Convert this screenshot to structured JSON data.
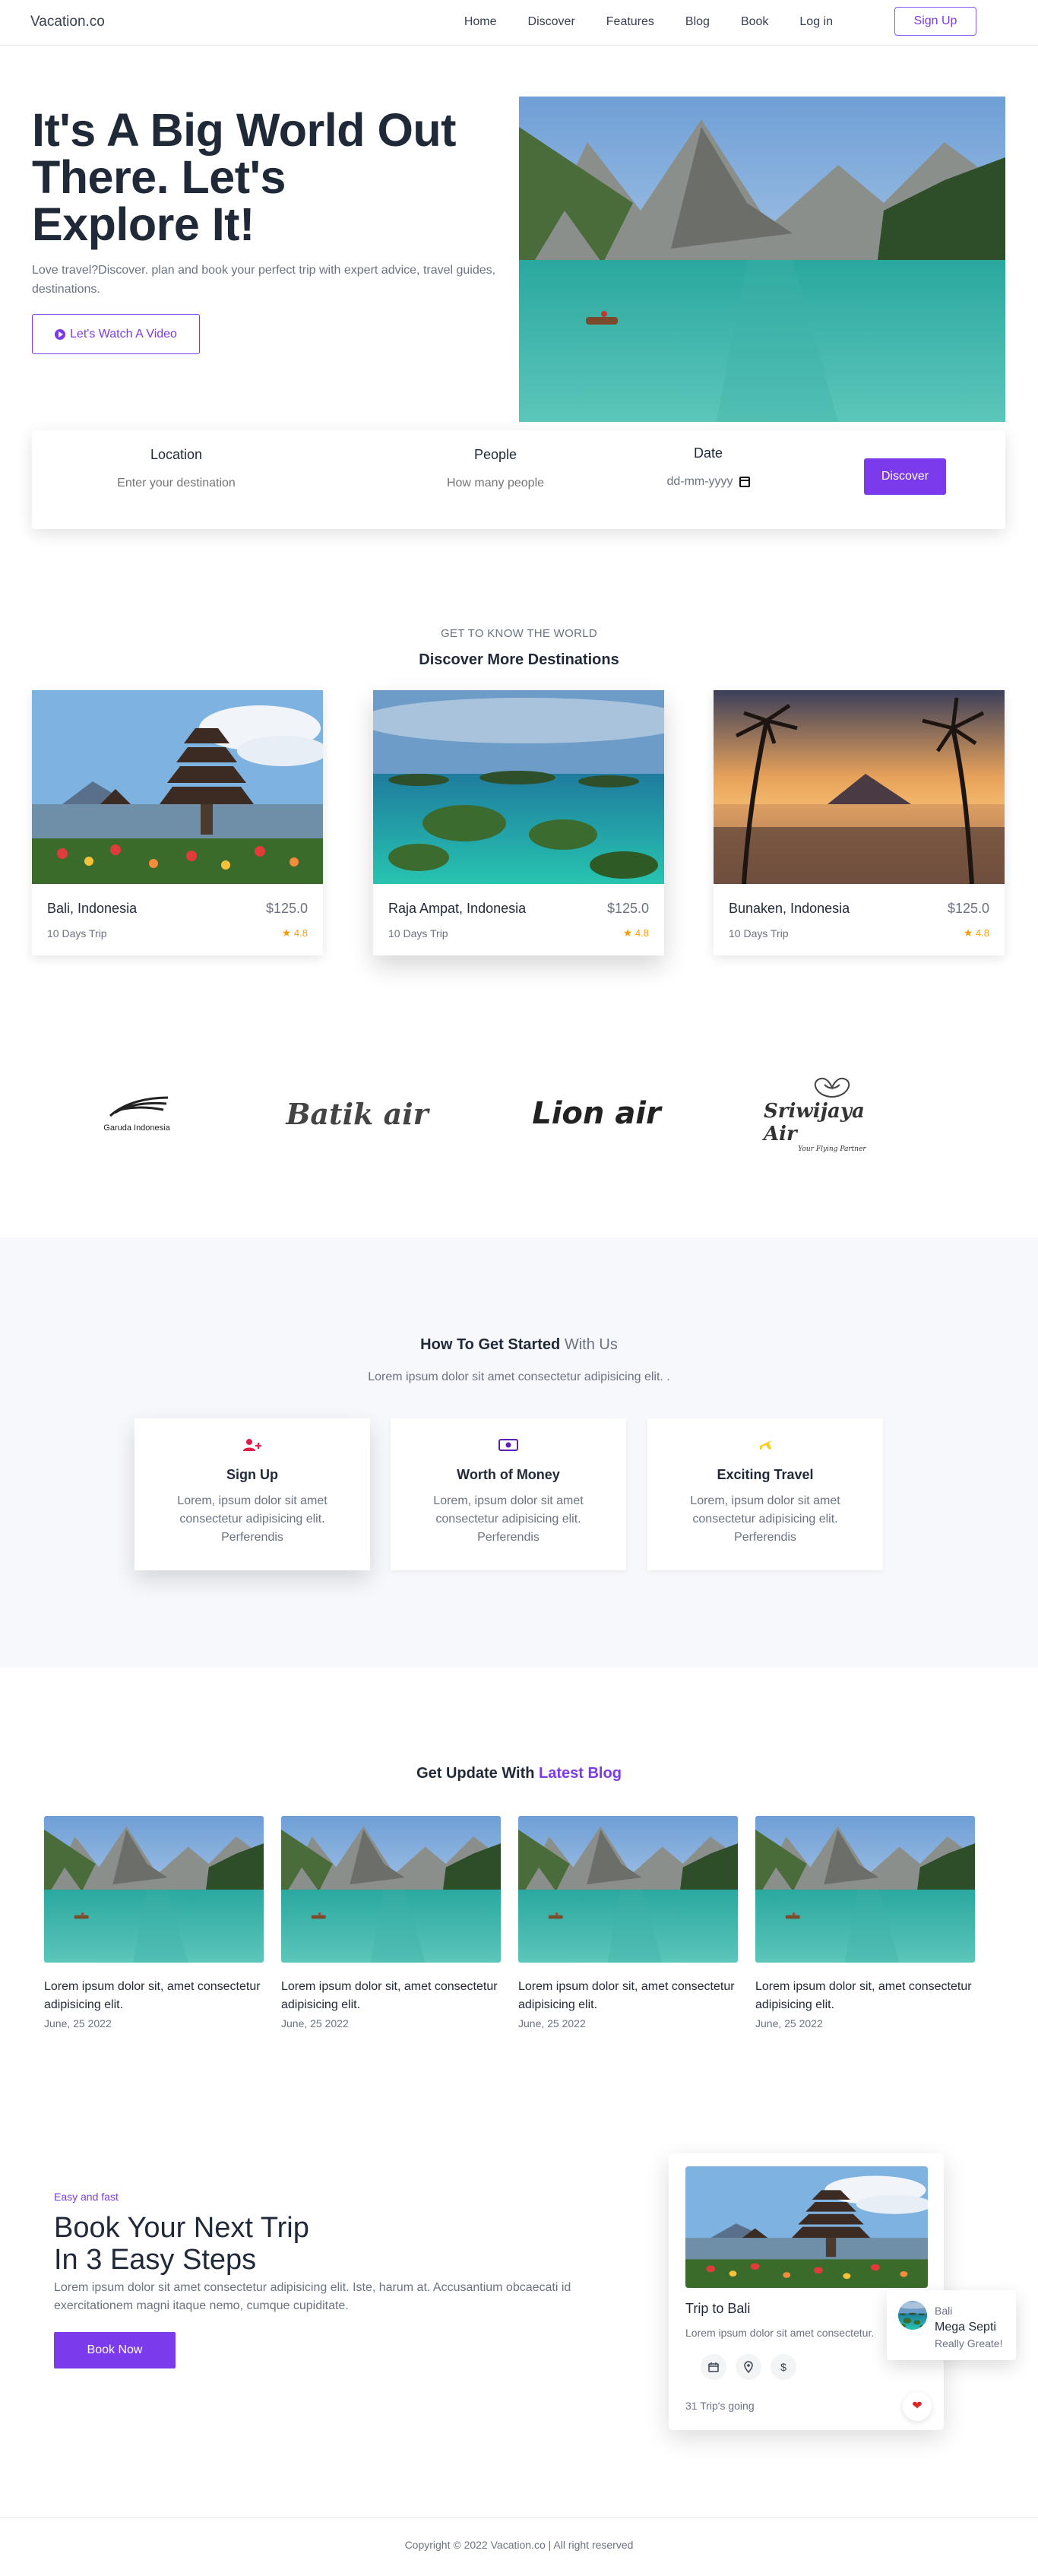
{
  "nav": {
    "logo": "Vacation.co",
    "links": [
      "Home",
      "Discover",
      "Features",
      "Blog",
      "Book",
      "Log in"
    ],
    "signup": "Sign Up"
  },
  "hero": {
    "title": "It's A Big World Out There. Let's Explore It!",
    "description": "Love travel?Discover. plan and book your perfect trip with expert advice, travel guides, destinations.",
    "video_button": "Let's Watch A Video"
  },
  "search": {
    "location_label": "Location",
    "location_placeholder": "Enter your destination",
    "people_label": "People",
    "people_placeholder": "How many people",
    "date_label": "Date",
    "date_placeholder": "dd-mm-yyyy",
    "button": "Discover"
  },
  "destinations": {
    "eyebrow": "GET TO KNOW THE WORLD",
    "title": "Discover More Destinations",
    "cards": [
      {
        "name": "Bali, Indonesia",
        "price": "$125.0",
        "trip": "10 Days Trip",
        "rating": "4.8"
      },
      {
        "name": "Raja Ampat, Indonesia",
        "price": "$125.0",
        "trip": "10 Days Trip",
        "rating": "4.8"
      },
      {
        "name": "Bunaken, Indonesia",
        "price": "$125.0",
        "trip": "10 Days Trip",
        "rating": "4.8"
      }
    ]
  },
  "airlines": {
    "garuda": "Garuda Indonesia",
    "batik": "Batik air",
    "lion": "Lion air",
    "sriwijaya": "Sriwijaya Air",
    "sriwijaya_tagline": "Your Flying Partner"
  },
  "how": {
    "title_main": "How To Get Started",
    "title_muted": "With Us",
    "subtitle": "Lorem ipsum dolor sit amet consectetur adipisicing elit. .",
    "cards": [
      {
        "title": "Sign Up",
        "desc": "Lorem, ipsum dolor sit amet consectetur adipisicing elit. Perferendis",
        "icon": "user-plus-icon"
      },
      {
        "title": "Worth of Money",
        "desc": "Lorem, ipsum dolor sit amet consectetur adipisicing elit. Perferendis",
        "icon": "money-icon"
      },
      {
        "title": "Exciting Travel",
        "desc": "Lorem, ipsum dolor sit amet consectetur adipisicing elit. Perferendis",
        "icon": "plane-icon"
      }
    ]
  },
  "blog": {
    "title_main": "Get Update With",
    "title_accent": "Latest Blog",
    "posts": [
      {
        "text": "Lorem ipsum dolor sit, amet consectetur adipisicing elit.",
        "date": "June, 25 2022"
      },
      {
        "text": "Lorem ipsum dolor sit, amet consectetur adipisicing elit.",
        "date": "June, 25 2022"
      },
      {
        "text": "Lorem ipsum dolor sit, amet consectetur adipisicing elit.",
        "date": "June, 25 2022"
      },
      {
        "text": "Lorem ipsum dolor sit, amet consectetur adipisicing elit.",
        "date": "June, 25 2022"
      }
    ]
  },
  "book": {
    "eyebrow": "Easy and fast",
    "title_line1": "Book Your Next Trip",
    "title_line2": "In 3 Easy Steps",
    "description": "Lorem ipsum dolor sit amet consectetur adipisicing elit. Iste, harum at. Accusantium obcaecati id exercitationem magni itaque nemo, cumque cupiditate.",
    "button": "Book Now",
    "trip_card": {
      "name": "Trip to Bali",
      "desc": "Lorem ipsum dolor sit amet consectetur.",
      "going": "31 Trip's going",
      "icons": [
        "calendar-icon",
        "location-pin-icon",
        "dollar-icon"
      ]
    },
    "float_card": {
      "place": "Bali",
      "name": "Mega Septi",
      "note": "Really Greate!"
    }
  },
  "footer": {
    "copyright": "Copyright © 2022 Vacation.co | All right reserved"
  },
  "colors": {
    "accent": "#7c3aed",
    "text": "#1f2937",
    "muted": "#6b7280",
    "star": "#f59e0b",
    "section_bg": "#f7f8fc"
  }
}
